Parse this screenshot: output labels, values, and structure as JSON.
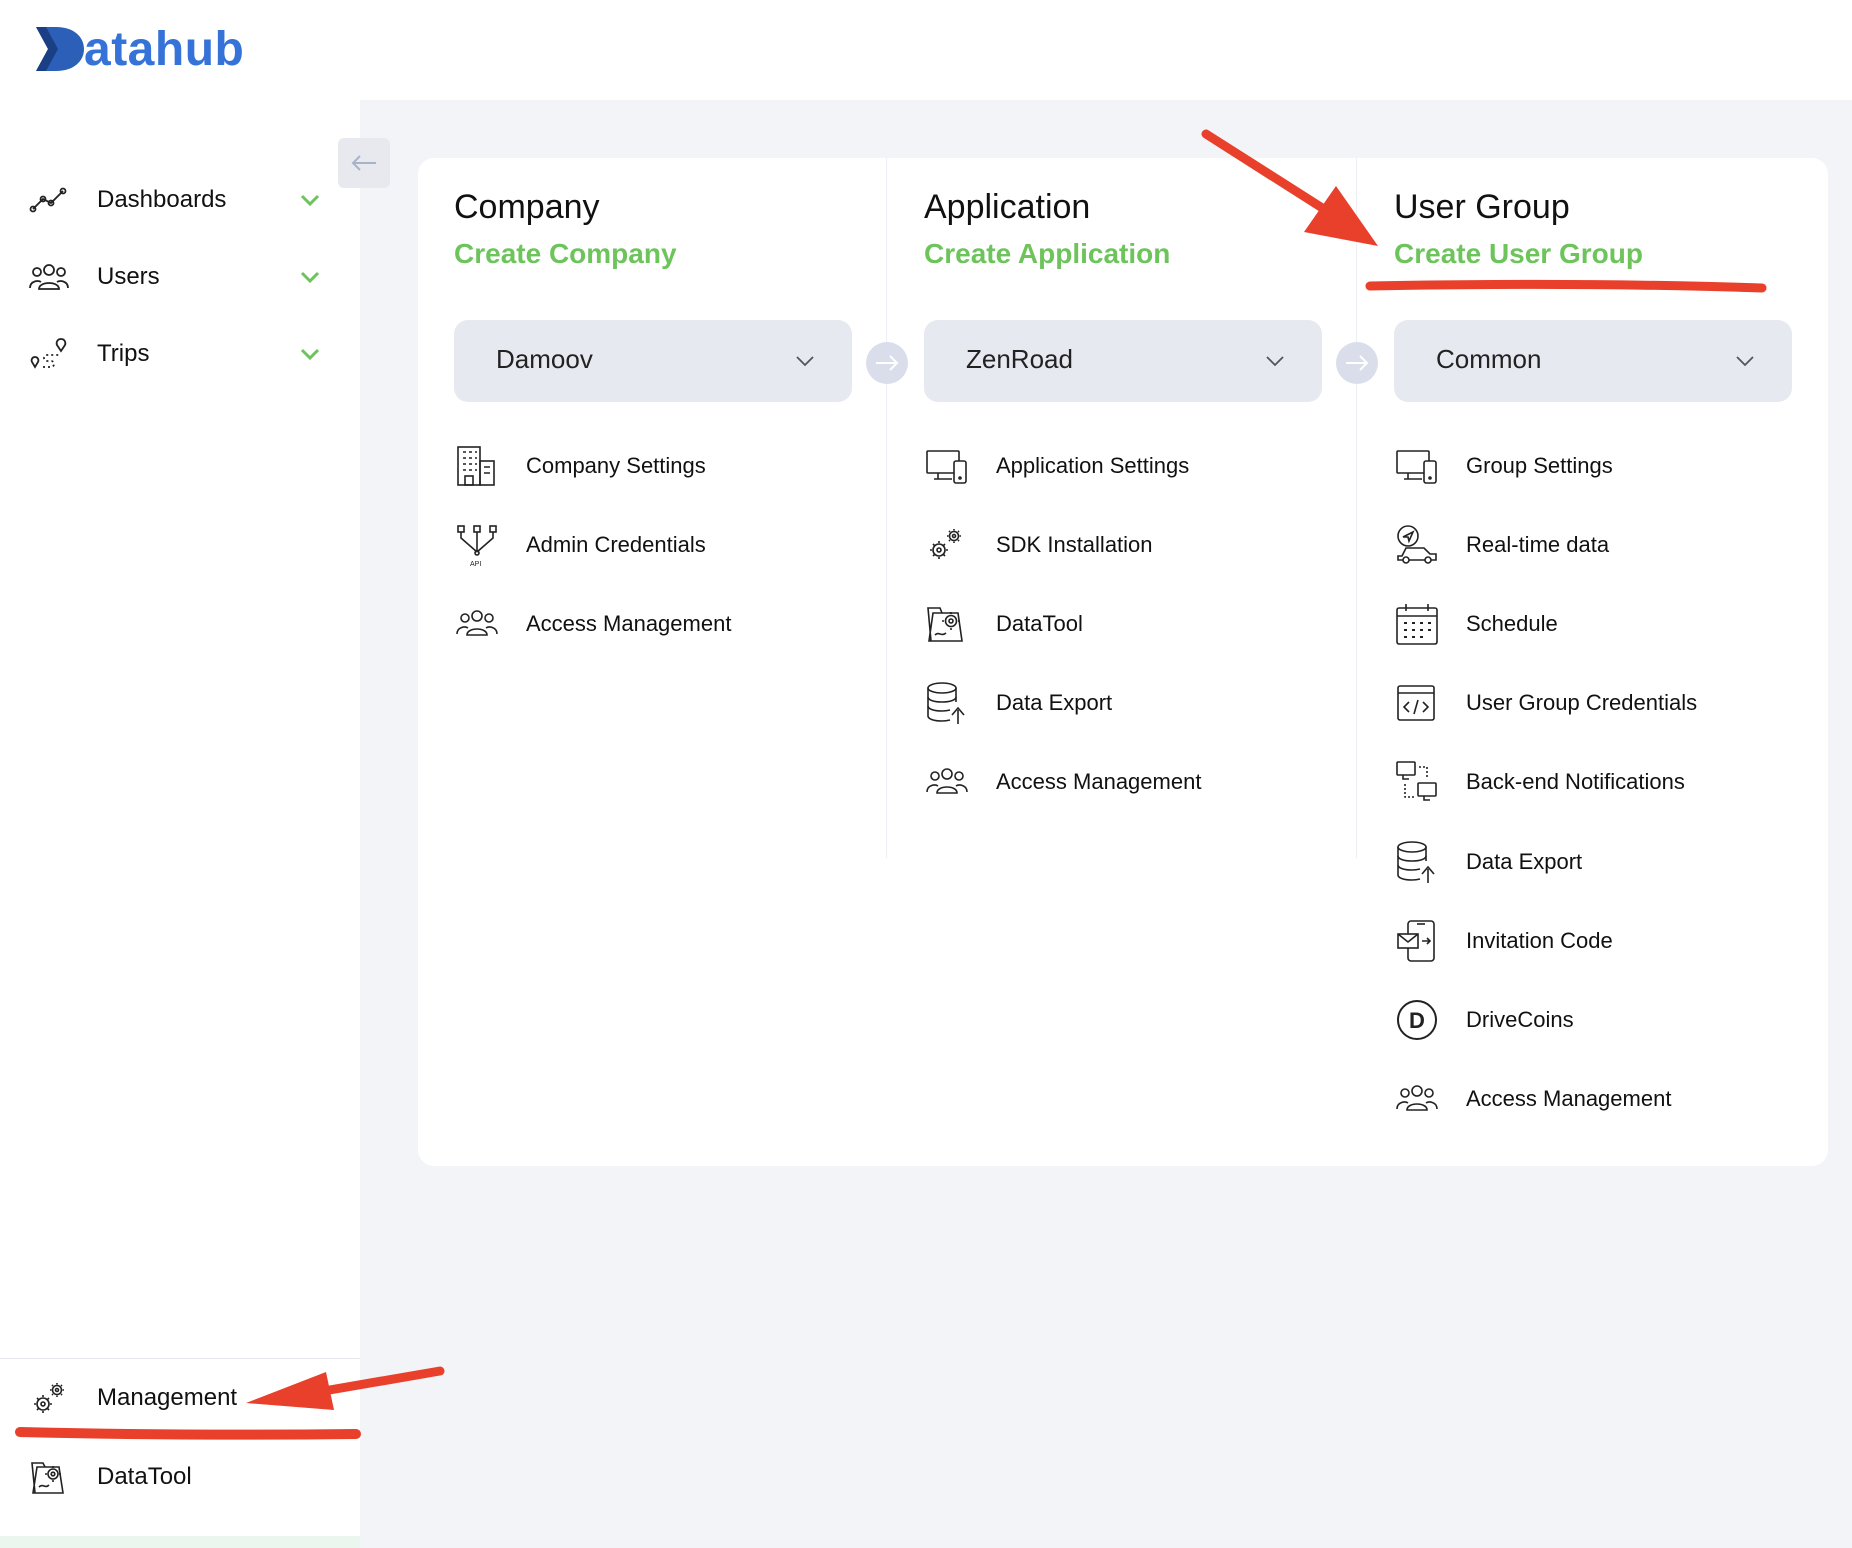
{
  "app": {
    "logo_text": "atahub",
    "logo_letter": "D"
  },
  "sidebar": {
    "items": [
      {
        "label": "Dashboards",
        "icon": "chart-line-icon"
      },
      {
        "label": "Users",
        "icon": "users-icon"
      },
      {
        "label": "Trips",
        "icon": "route-icon"
      }
    ],
    "bottom": [
      {
        "label": "Management",
        "icon": "gears-icon"
      },
      {
        "label": "DataTool",
        "icon": "datatool-icon"
      }
    ]
  },
  "columns": [
    {
      "title": "Company",
      "create": "Create Company",
      "selected": "Damoov",
      "items": [
        {
          "label": "Company Settings",
          "icon": "building-icon"
        },
        {
          "label": "Admin Credentials",
          "icon": "api-icon"
        },
        {
          "label": "Access Management",
          "icon": "users-icon"
        }
      ]
    },
    {
      "title": "Application",
      "create": "Create Application",
      "selected": "ZenRoad",
      "items": [
        {
          "label": "Application Settings",
          "icon": "devices-icon"
        },
        {
          "label": "SDK Installation",
          "icon": "gears-icon"
        },
        {
          "label": "DataTool",
          "icon": "datatool-icon"
        },
        {
          "label": "Data Export",
          "icon": "database-export-icon"
        },
        {
          "label": "Access Management",
          "icon": "users-icon"
        }
      ]
    },
    {
      "title": "User Group",
      "create": "Create User Group",
      "selected": "Common",
      "items": [
        {
          "label": "Group Settings",
          "icon": "devices-icon"
        },
        {
          "label": "Real-time data",
          "icon": "car-location-icon"
        },
        {
          "label": "Schedule",
          "icon": "calendar-icon"
        },
        {
          "label": "User Group Credentials",
          "icon": "code-window-icon"
        },
        {
          "label": "Back-end Notifications",
          "icon": "notifications-icon"
        },
        {
          "label": "Data Export",
          "icon": "database-export-icon"
        },
        {
          "label": "Invitation Code",
          "icon": "invitation-icon"
        },
        {
          "label": "DriveCoins",
          "icon": "drivecoins-icon"
        },
        {
          "label": "Access Management",
          "icon": "users-icon"
        }
      ]
    }
  ],
  "colors": {
    "brand": "#3573d8",
    "accent": "#6cc45b",
    "annotation": "#e8402a"
  }
}
